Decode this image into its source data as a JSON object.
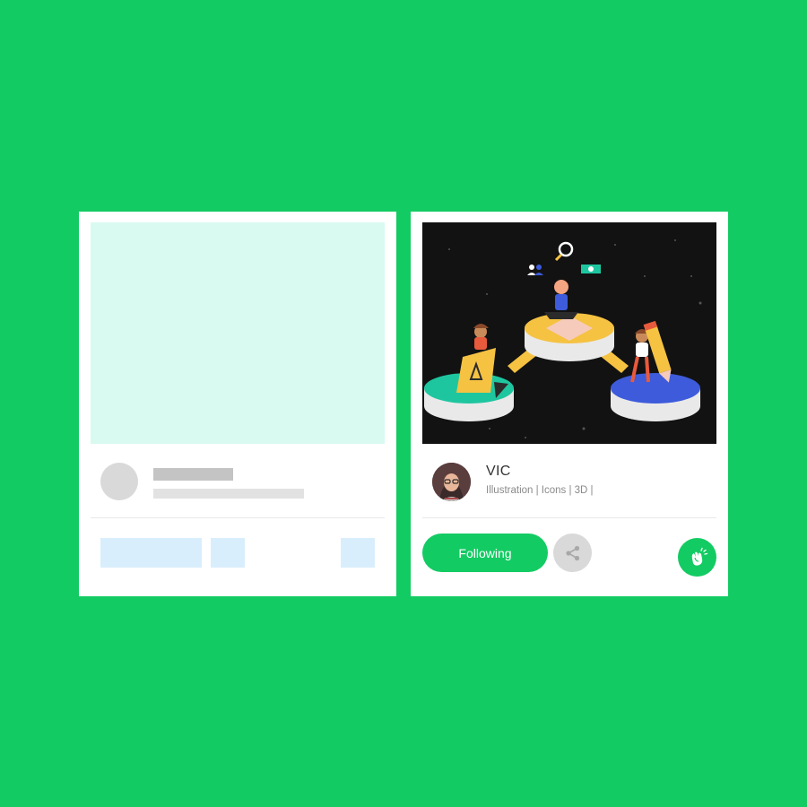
{
  "skeleton_card": {
    "state": "loading-placeholder"
  },
  "project_card": {
    "cover": {
      "alt": "illustration-cover"
    },
    "creator": {
      "name": "VIC",
      "tags": "Illustration | Icons | 3D |"
    },
    "follow_button": {
      "label": "Following"
    },
    "share_button": {
      "icon": "share-icon"
    },
    "appreciate_button": {
      "icon": "clap-icon"
    }
  },
  "colors": {
    "background": "#13cb63",
    "card": "#ffffff",
    "accent": "#13cb63",
    "skeleton_image": "#d9faf1",
    "skeleton_gray": "#d9d9d9",
    "skeleton_button": "#d9eefc"
  }
}
